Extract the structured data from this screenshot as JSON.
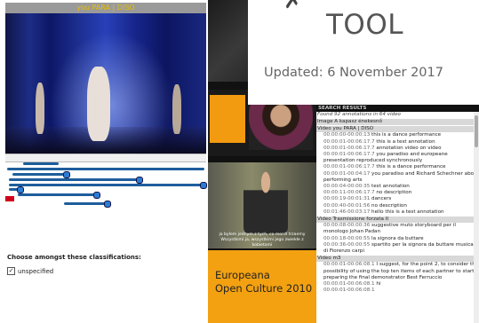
{
  "player": {
    "video_title": "you PARA | DISO",
    "classification_label": "Choose amongst these classifications:",
    "checkbox_label": "unspecified",
    "checkbox_checked": true
  },
  "overlay": {
    "title": "TOOL",
    "updated": "Updated: 6 November 2017"
  },
  "thumbs": {
    "subtitle_line1": "ja byłem jednym z tych, co mordl trzaemy",
    "subtitle_line2": "Wszystkimi ja, wszystkimi jego zwiekłe z kobietami",
    "europeana_line1": "Europeana",
    "europeana_line2": "Open Culture 2010"
  },
  "results": {
    "header": "SEARCH RESULTS",
    "found": "Found 92 annotations in 64 video",
    "groups": [
      {
        "label": "Image A kapasz énekesnő",
        "rows": []
      },
      {
        "label": "Video you PARA | DISO",
        "rows": [
          {
            "t": "00:00:00-00:00:13",
            "text": "this is a dance performance"
          },
          {
            "t": "00:00:01-00:06:17.7",
            "text": "this is a test annotation"
          },
          {
            "t": "00:00:01-00:06:17.7",
            "text": "annotation video on video"
          },
          {
            "t": "00:00:01-00:06:17.7",
            "text": "you paradiso and europeane presentation reproduced synchronously"
          },
          {
            "t": "00:00:01-00:06:17.7",
            "text": "this is a dance performance"
          },
          {
            "t": "00:00:01-00:04:17",
            "text": "you paradiso and Richard Schechner about performing arts"
          },
          {
            "t": "00:00:04-00:00:35",
            "text": "test annotation"
          },
          {
            "t": "00:00:11-00:06:17.7",
            "text": "no description"
          },
          {
            "t": "00:00:19-00:01:31",
            "text": "dancers"
          },
          {
            "t": "00:00:40-00:01:56",
            "text": "no description"
          },
          {
            "t": "00:01:46-00:03:17",
            "text": "hello this is a test annotation"
          }
        ]
      },
      {
        "label": "Video Trasmissione forzata II",
        "rows": [
          {
            "t": "00:00:08-00:00:36",
            "text": "suggestive muto storyboard per il monologo Johan Padan"
          },
          {
            "t": "00:00:18-00:00:55",
            "text": "la signora da buttare"
          },
          {
            "t": "00:00:36-00:00:55",
            "text": "spartito per la signora da buttare musica di Fiorenzo carpi"
          }
        ]
      },
      {
        "label": "Video m3",
        "rows": [
          {
            "t": "00:00:01-00:06:08.1",
            "text": "I suggest, for the point 2, to consider the possibility of using the top ten items of each partner to start preparing the final demonstrator Best Ferruccio"
          },
          {
            "t": "00:00:01-00:06:08.1",
            "text": "hi"
          },
          {
            "t": "00:00:01-00:06:08.1",
            "text": ""
          }
        ]
      }
    ]
  }
}
